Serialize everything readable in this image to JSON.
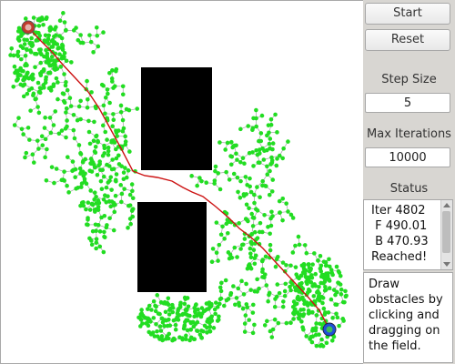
{
  "controls": {
    "start_label": "Start",
    "reset_label": "Reset",
    "step_size_label": "Step Size",
    "step_size_value": "5",
    "max_iterations_label": "Max Iterations",
    "max_iterations_value": "10000",
    "status_label": "Status"
  },
  "status": {
    "text": "Iter 4802\n F 490.01\n B 470.93\nReached!"
  },
  "help": {
    "text": "Draw obstacles by clicking and dragging on the field."
  },
  "colors": {
    "node": "#22dd22",
    "edge": "#a0a0a0",
    "path": "#cc1111",
    "obstacle": "#000000",
    "start_marker": "#c0392b",
    "goal_marker": "#1f4fd8"
  },
  "icons": [
    "start-marker-icon",
    "goal-marker-icon"
  ]
}
